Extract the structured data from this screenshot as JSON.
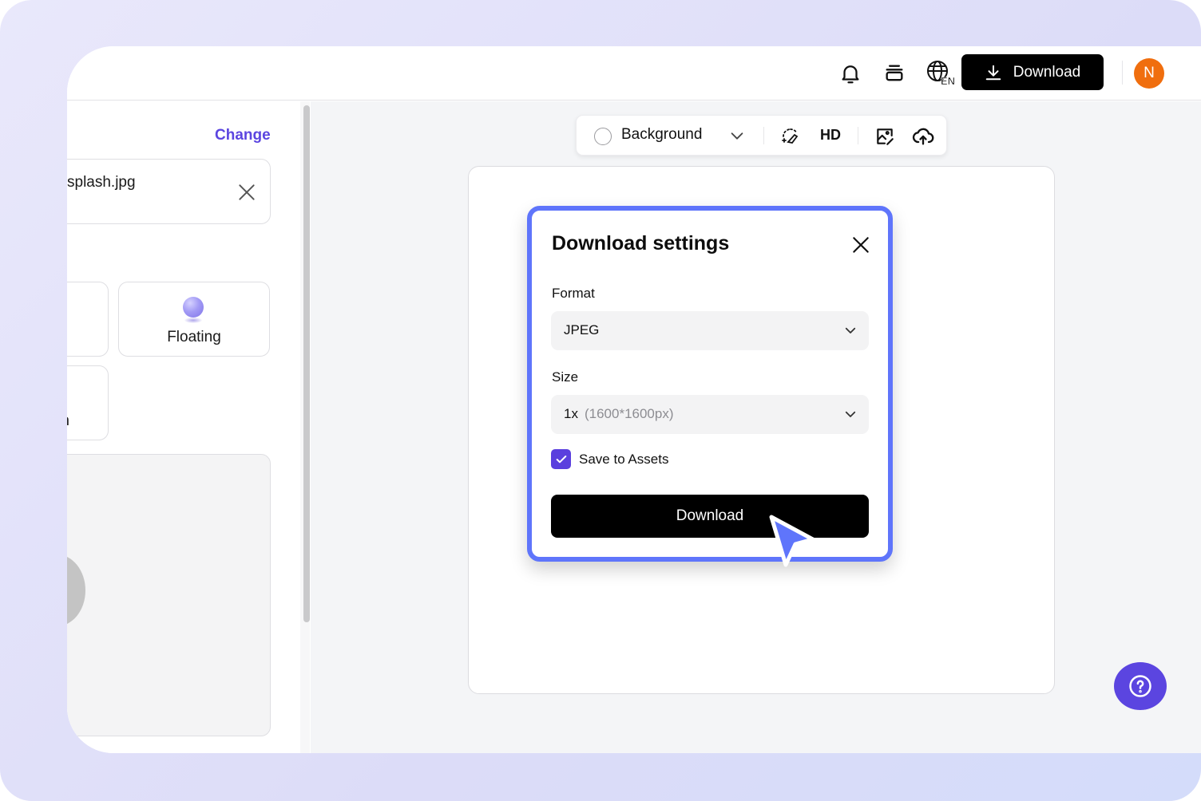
{
  "topbar": {
    "icons": [
      "bell-icon",
      "layers-icon",
      "language-icon"
    ],
    "language_badge": "EN",
    "download_label": "Download",
    "avatar_initial": "N"
  },
  "left_panel": {
    "change_label": "Change",
    "file_name": "splash.jpg",
    "effects": [
      {
        "label": "",
        "state": "partial"
      },
      {
        "label": "Floating",
        "state": "visible"
      },
      {
        "label": "n",
        "state": "partial"
      }
    ]
  },
  "toolbar": {
    "background_label": "Background",
    "hd_label": "HD"
  },
  "modal": {
    "title": "Download settings",
    "format_label": "Format",
    "format_value": "JPEG",
    "size_label": "Size",
    "size_value": "1x",
    "size_hint": "(1600*1600px)",
    "save_to_assets_label": "Save to Assets",
    "save_to_assets_checked": true,
    "download_label": "Download"
  },
  "colors": {
    "accent": "#5b45e0",
    "modal_border": "#5f75fb",
    "avatar": "#f06e0e",
    "cursor": "#5f75fb"
  }
}
